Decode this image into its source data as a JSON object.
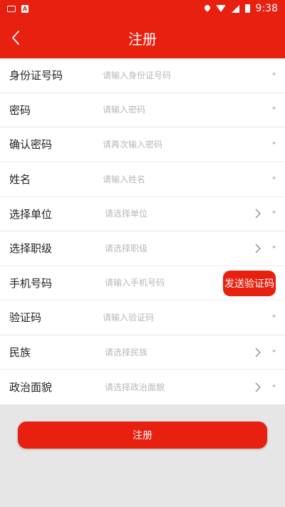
{
  "status_bar": {
    "time": "9:38"
  },
  "header": {
    "title": "注册"
  },
  "form": {
    "rows": [
      {
        "label": "身份证号码",
        "placeholder": "请输入身份证号码",
        "required": "*"
      },
      {
        "label": "密码",
        "placeholder": "请输入密码",
        "required": "*"
      },
      {
        "label": "确认密码",
        "placeholder": "请再次输入密码",
        "required": "*"
      },
      {
        "label": "姓名",
        "placeholder": "请输入姓名",
        "required": "*"
      },
      {
        "label": "选择单位",
        "placeholder": "请选择单位",
        "required": "*"
      },
      {
        "label": "选择职级",
        "placeholder": "请选择职级",
        "required": "*"
      },
      {
        "label": "手机号码",
        "placeholder": "请输入手机号码",
        "button": "发送验证码"
      },
      {
        "label": "验证码",
        "placeholder": "请输入验证码",
        "required": "*"
      },
      {
        "label": "民族",
        "placeholder": "请选择民族",
        "required": "*"
      },
      {
        "label": "政治面貌",
        "placeholder": "请选择政治面貌",
        "required": "*"
      }
    ]
  },
  "submit_label": "注册",
  "colors": {
    "primary": "#e8200f",
    "background": "#e6e6e6"
  }
}
